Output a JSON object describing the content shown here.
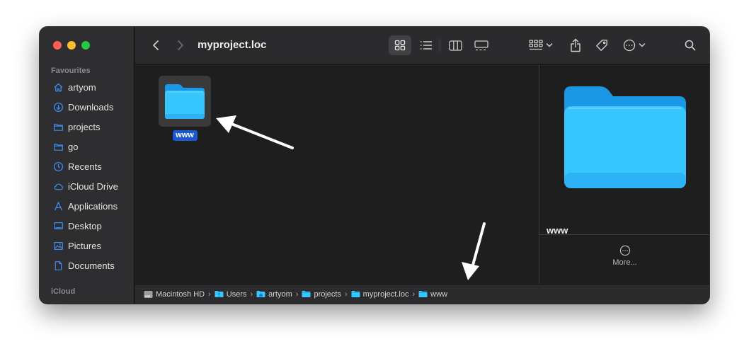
{
  "window": {
    "title": "myproject.loc"
  },
  "sidebar": {
    "favourites_header": "Favourites",
    "icloud_header": "iCloud",
    "items": [
      {
        "label": "artyom",
        "icon": "home-icon"
      },
      {
        "label": "Downloads",
        "icon": "download-icon"
      },
      {
        "label": "projects",
        "icon": "folder-icon"
      },
      {
        "label": "go",
        "icon": "folder-icon"
      },
      {
        "label": "Recents",
        "icon": "clock-icon"
      },
      {
        "label": "iCloud Drive",
        "icon": "cloud-icon"
      },
      {
        "label": "Applications",
        "icon": "applications-icon"
      },
      {
        "label": "Desktop",
        "icon": "desktop-icon"
      },
      {
        "label": "Pictures",
        "icon": "photo-icon"
      },
      {
        "label": "Documents",
        "icon": "document-icon"
      }
    ]
  },
  "content": {
    "items": [
      {
        "name": "www",
        "kind": "folder",
        "selected": true
      }
    ]
  },
  "preview": {
    "name": "www",
    "more_label": "More..."
  },
  "pathbar": {
    "crumbs": [
      {
        "label": "Macintosh HD",
        "icon": "harddrive-icon"
      },
      {
        "label": "Users",
        "icon": "users-folder-icon"
      },
      {
        "label": "artyom",
        "icon": "home-folder-icon"
      },
      {
        "label": "projects",
        "icon": "folder-icon"
      },
      {
        "label": "myproject.loc",
        "icon": "folder-icon"
      },
      {
        "label": "www",
        "icon": "folder-icon"
      }
    ],
    "separator": "›"
  },
  "colors": {
    "accent": "#1c59d0",
    "sidebar_icon": "#3b8cf0",
    "folder_light": "#38c6ff",
    "folder_dark": "#1a98e6"
  }
}
